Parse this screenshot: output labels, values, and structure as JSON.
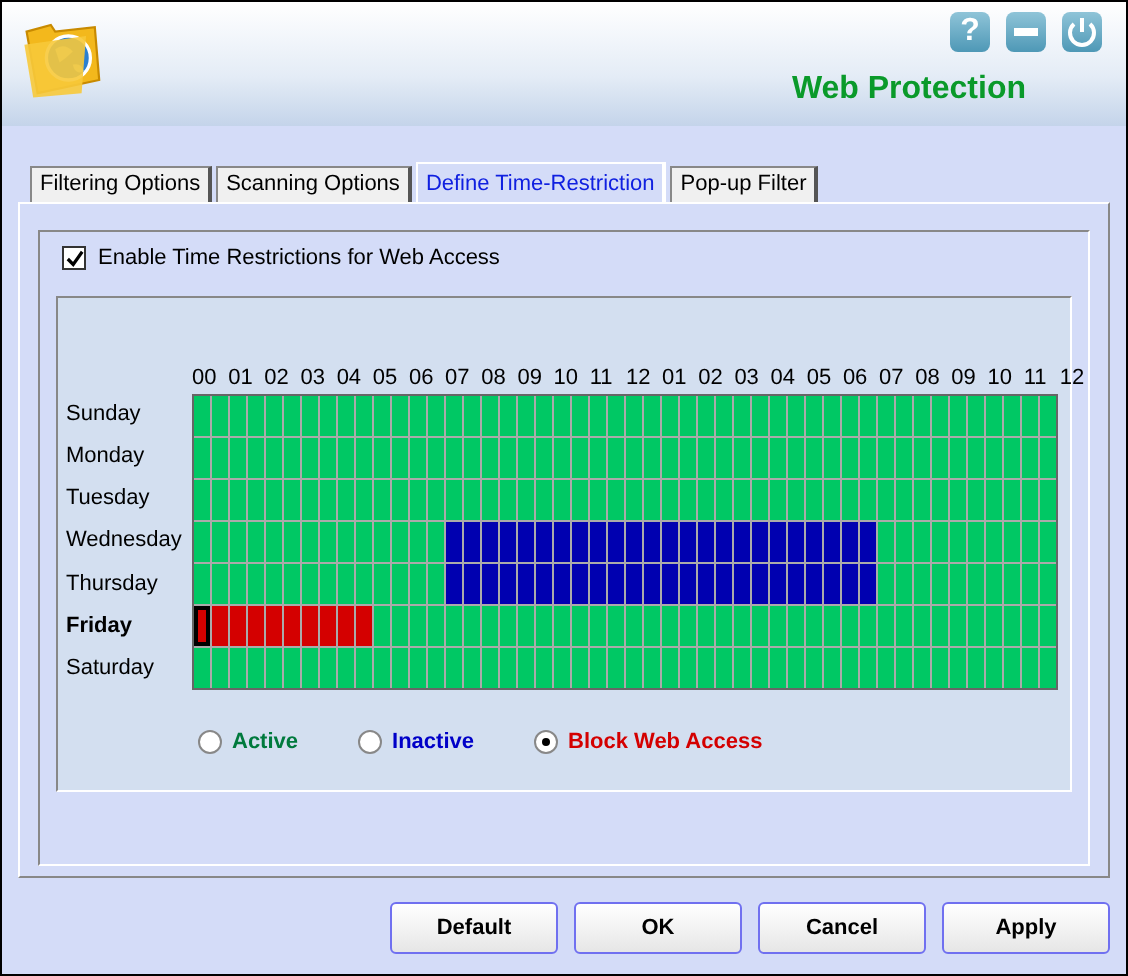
{
  "window": {
    "title": "Web Protection",
    "help_button": "?"
  },
  "tabs": [
    {
      "label": "Filtering Options",
      "selected": false
    },
    {
      "label": "Scanning Options",
      "selected": false
    },
    {
      "label": "Define Time-Restriction",
      "selected": true
    },
    {
      "label": "Pop-up Filter",
      "selected": false
    }
  ],
  "enable": {
    "label": "Enable Time Restrictions for Web Access",
    "checked": true
  },
  "hours": [
    "00",
    "01",
    "02",
    "03",
    "04",
    "05",
    "06",
    "07",
    "08",
    "09",
    "10",
    "11",
    "12",
    "01",
    "02",
    "03",
    "04",
    "05",
    "06",
    "07",
    "08",
    "09",
    "10",
    "11",
    "12"
  ],
  "days": [
    {
      "name": "Sunday",
      "selected": false,
      "slots": [
        {
          "kind": "active"
        },
        {
          "kind": "active"
        },
        {
          "kind": "active"
        },
        {
          "kind": "active"
        },
        {
          "kind": "active"
        },
        {
          "kind": "active"
        },
        {
          "kind": "active"
        },
        {
          "kind": "active"
        },
        {
          "kind": "active"
        },
        {
          "kind": "active"
        },
        {
          "kind": "active"
        },
        {
          "kind": "active"
        },
        {
          "kind": "active"
        },
        {
          "kind": "active"
        },
        {
          "kind": "active"
        },
        {
          "kind": "active"
        },
        {
          "kind": "active"
        },
        {
          "kind": "active"
        },
        {
          "kind": "active"
        },
        {
          "kind": "active"
        },
        {
          "kind": "active"
        },
        {
          "kind": "active"
        },
        {
          "kind": "active"
        },
        {
          "kind": "active"
        },
        {
          "kind": "active"
        },
        {
          "kind": "active"
        },
        {
          "kind": "active"
        },
        {
          "kind": "active"
        },
        {
          "kind": "active"
        },
        {
          "kind": "active"
        },
        {
          "kind": "active"
        },
        {
          "kind": "active"
        },
        {
          "kind": "active"
        },
        {
          "kind": "active"
        },
        {
          "kind": "active"
        },
        {
          "kind": "active"
        },
        {
          "kind": "active"
        },
        {
          "kind": "active"
        },
        {
          "kind": "active"
        },
        {
          "kind": "active"
        },
        {
          "kind": "active"
        },
        {
          "kind": "active"
        },
        {
          "kind": "active"
        },
        {
          "kind": "active"
        },
        {
          "kind": "active"
        },
        {
          "kind": "active"
        },
        {
          "kind": "active"
        },
        {
          "kind": "active"
        }
      ]
    },
    {
      "name": "Monday",
      "selected": false,
      "slots": [
        {
          "kind": "active"
        },
        {
          "kind": "active"
        },
        {
          "kind": "active"
        },
        {
          "kind": "active"
        },
        {
          "kind": "active"
        },
        {
          "kind": "active"
        },
        {
          "kind": "active"
        },
        {
          "kind": "active"
        },
        {
          "kind": "active"
        },
        {
          "kind": "active"
        },
        {
          "kind": "active"
        },
        {
          "kind": "active"
        },
        {
          "kind": "active"
        },
        {
          "kind": "active"
        },
        {
          "kind": "active"
        },
        {
          "kind": "active"
        },
        {
          "kind": "active"
        },
        {
          "kind": "active"
        },
        {
          "kind": "active"
        },
        {
          "kind": "active"
        },
        {
          "kind": "active"
        },
        {
          "kind": "active"
        },
        {
          "kind": "active"
        },
        {
          "kind": "active"
        },
        {
          "kind": "active"
        },
        {
          "kind": "active"
        },
        {
          "kind": "active"
        },
        {
          "kind": "active"
        },
        {
          "kind": "active"
        },
        {
          "kind": "active"
        },
        {
          "kind": "active"
        },
        {
          "kind": "active"
        },
        {
          "kind": "active"
        },
        {
          "kind": "active"
        },
        {
          "kind": "active"
        },
        {
          "kind": "active"
        },
        {
          "kind": "active"
        },
        {
          "kind": "active"
        },
        {
          "kind": "active"
        },
        {
          "kind": "active"
        },
        {
          "kind": "active"
        },
        {
          "kind": "active"
        },
        {
          "kind": "active"
        },
        {
          "kind": "active"
        },
        {
          "kind": "active"
        },
        {
          "kind": "active"
        },
        {
          "kind": "active"
        },
        {
          "kind": "active"
        }
      ]
    },
    {
      "name": "Tuesday",
      "selected": false,
      "slots": [
        {
          "kind": "active"
        },
        {
          "kind": "active"
        },
        {
          "kind": "active"
        },
        {
          "kind": "active"
        },
        {
          "kind": "active"
        },
        {
          "kind": "active"
        },
        {
          "kind": "active"
        },
        {
          "kind": "active"
        },
        {
          "kind": "active"
        },
        {
          "kind": "active"
        },
        {
          "kind": "active"
        },
        {
          "kind": "active"
        },
        {
          "kind": "active"
        },
        {
          "kind": "active"
        },
        {
          "kind": "active"
        },
        {
          "kind": "active"
        },
        {
          "kind": "active"
        },
        {
          "kind": "active"
        },
        {
          "kind": "active"
        },
        {
          "kind": "active"
        },
        {
          "kind": "active"
        },
        {
          "kind": "active"
        },
        {
          "kind": "active"
        },
        {
          "kind": "active"
        },
        {
          "kind": "active"
        },
        {
          "kind": "active"
        },
        {
          "kind": "active"
        },
        {
          "kind": "active"
        },
        {
          "kind": "active"
        },
        {
          "kind": "active"
        },
        {
          "kind": "active"
        },
        {
          "kind": "active"
        },
        {
          "kind": "active"
        },
        {
          "kind": "active"
        },
        {
          "kind": "active"
        },
        {
          "kind": "active"
        },
        {
          "kind": "active"
        },
        {
          "kind": "active"
        },
        {
          "kind": "active"
        },
        {
          "kind": "active"
        },
        {
          "kind": "active"
        },
        {
          "kind": "active"
        },
        {
          "kind": "active"
        },
        {
          "kind": "active"
        },
        {
          "kind": "active"
        },
        {
          "kind": "active"
        },
        {
          "kind": "active"
        },
        {
          "kind": "active"
        }
      ]
    },
    {
      "name": "Wednesday",
      "selected": false,
      "slots": [
        {
          "kind": "active"
        },
        {
          "kind": "active"
        },
        {
          "kind": "active"
        },
        {
          "kind": "active"
        },
        {
          "kind": "active"
        },
        {
          "kind": "active"
        },
        {
          "kind": "active"
        },
        {
          "kind": "active"
        },
        {
          "kind": "active"
        },
        {
          "kind": "active"
        },
        {
          "kind": "active"
        },
        {
          "kind": "active"
        },
        {
          "kind": "active"
        },
        {
          "kind": "active"
        },
        {
          "kind": "inactive"
        },
        {
          "kind": "inactive"
        },
        {
          "kind": "inactive"
        },
        {
          "kind": "inactive"
        },
        {
          "kind": "inactive"
        },
        {
          "kind": "inactive"
        },
        {
          "kind": "inactive"
        },
        {
          "kind": "inactive"
        },
        {
          "kind": "inactive"
        },
        {
          "kind": "inactive"
        },
        {
          "kind": "inactive"
        },
        {
          "kind": "inactive"
        },
        {
          "kind": "inactive"
        },
        {
          "kind": "inactive"
        },
        {
          "kind": "inactive"
        },
        {
          "kind": "inactive"
        },
        {
          "kind": "inactive"
        },
        {
          "kind": "inactive"
        },
        {
          "kind": "inactive"
        },
        {
          "kind": "inactive"
        },
        {
          "kind": "inactive"
        },
        {
          "kind": "inactive"
        },
        {
          "kind": "inactive"
        },
        {
          "kind": "inactive"
        },
        {
          "kind": "active"
        },
        {
          "kind": "active"
        },
        {
          "kind": "active"
        },
        {
          "kind": "active"
        },
        {
          "kind": "active"
        },
        {
          "kind": "active"
        },
        {
          "kind": "active"
        },
        {
          "kind": "active"
        },
        {
          "kind": "active"
        },
        {
          "kind": "active"
        }
      ]
    },
    {
      "name": "Thursday",
      "selected": false,
      "slots": [
        {
          "kind": "active"
        },
        {
          "kind": "active"
        },
        {
          "kind": "active"
        },
        {
          "kind": "active"
        },
        {
          "kind": "active"
        },
        {
          "kind": "active"
        },
        {
          "kind": "active"
        },
        {
          "kind": "active"
        },
        {
          "kind": "active"
        },
        {
          "kind": "active"
        },
        {
          "kind": "active"
        },
        {
          "kind": "active"
        },
        {
          "kind": "active"
        },
        {
          "kind": "active"
        },
        {
          "kind": "inactive"
        },
        {
          "kind": "inactive"
        },
        {
          "kind": "inactive"
        },
        {
          "kind": "inactive"
        },
        {
          "kind": "inactive"
        },
        {
          "kind": "inactive"
        },
        {
          "kind": "inactive"
        },
        {
          "kind": "inactive"
        },
        {
          "kind": "inactive"
        },
        {
          "kind": "inactive"
        },
        {
          "kind": "inactive"
        },
        {
          "kind": "inactive"
        },
        {
          "kind": "inactive"
        },
        {
          "kind": "inactive"
        },
        {
          "kind": "inactive"
        },
        {
          "kind": "inactive"
        },
        {
          "kind": "inactive"
        },
        {
          "kind": "inactive"
        },
        {
          "kind": "inactive"
        },
        {
          "kind": "inactive"
        },
        {
          "kind": "inactive"
        },
        {
          "kind": "inactive"
        },
        {
          "kind": "inactive"
        },
        {
          "kind": "inactive"
        },
        {
          "kind": "active"
        },
        {
          "kind": "active"
        },
        {
          "kind": "active"
        },
        {
          "kind": "active"
        },
        {
          "kind": "active"
        },
        {
          "kind": "active"
        },
        {
          "kind": "active"
        },
        {
          "kind": "active"
        },
        {
          "kind": "active"
        },
        {
          "kind": "active"
        }
      ]
    },
    {
      "name": "Friday",
      "selected": true,
      "slots": [
        {
          "kind": "block",
          "focused": true
        },
        {
          "kind": "block"
        },
        {
          "kind": "block"
        },
        {
          "kind": "block"
        },
        {
          "kind": "block"
        },
        {
          "kind": "block"
        },
        {
          "kind": "block"
        },
        {
          "kind": "block"
        },
        {
          "kind": "block"
        },
        {
          "kind": "block"
        },
        {
          "kind": "active"
        },
        {
          "kind": "active"
        },
        {
          "kind": "active"
        },
        {
          "kind": "active"
        },
        {
          "kind": "active"
        },
        {
          "kind": "active"
        },
        {
          "kind": "active"
        },
        {
          "kind": "active"
        },
        {
          "kind": "active"
        },
        {
          "kind": "active"
        },
        {
          "kind": "active"
        },
        {
          "kind": "active"
        },
        {
          "kind": "active"
        },
        {
          "kind": "active"
        },
        {
          "kind": "active"
        },
        {
          "kind": "active"
        },
        {
          "kind": "active"
        },
        {
          "kind": "active"
        },
        {
          "kind": "active"
        },
        {
          "kind": "active"
        },
        {
          "kind": "active"
        },
        {
          "kind": "active"
        },
        {
          "kind": "active"
        },
        {
          "kind": "active"
        },
        {
          "kind": "active"
        },
        {
          "kind": "active"
        },
        {
          "kind": "active"
        },
        {
          "kind": "active"
        },
        {
          "kind": "active"
        },
        {
          "kind": "active"
        },
        {
          "kind": "active"
        },
        {
          "kind": "active"
        },
        {
          "kind": "active"
        },
        {
          "kind": "active"
        },
        {
          "kind": "active"
        },
        {
          "kind": "active"
        },
        {
          "kind": "active"
        },
        {
          "kind": "active"
        }
      ]
    },
    {
      "name": "Saturday",
      "selected": false,
      "slots": [
        {
          "kind": "active"
        },
        {
          "kind": "active"
        },
        {
          "kind": "active"
        },
        {
          "kind": "active"
        },
        {
          "kind": "active"
        },
        {
          "kind": "active"
        },
        {
          "kind": "active"
        },
        {
          "kind": "active"
        },
        {
          "kind": "active"
        },
        {
          "kind": "active"
        },
        {
          "kind": "active"
        },
        {
          "kind": "active"
        },
        {
          "kind": "active"
        },
        {
          "kind": "active"
        },
        {
          "kind": "active"
        },
        {
          "kind": "active"
        },
        {
          "kind": "active"
        },
        {
          "kind": "active"
        },
        {
          "kind": "active"
        },
        {
          "kind": "active"
        },
        {
          "kind": "active"
        },
        {
          "kind": "active"
        },
        {
          "kind": "active"
        },
        {
          "kind": "active"
        },
        {
          "kind": "active"
        },
        {
          "kind": "active"
        },
        {
          "kind": "active"
        },
        {
          "kind": "active"
        },
        {
          "kind": "active"
        },
        {
          "kind": "active"
        },
        {
          "kind": "active"
        },
        {
          "kind": "active"
        },
        {
          "kind": "active"
        },
        {
          "kind": "active"
        },
        {
          "kind": "active"
        },
        {
          "kind": "active"
        },
        {
          "kind": "active"
        },
        {
          "kind": "active"
        },
        {
          "kind": "active"
        },
        {
          "kind": "active"
        },
        {
          "kind": "active"
        },
        {
          "kind": "active"
        },
        {
          "kind": "active"
        },
        {
          "kind": "active"
        },
        {
          "kind": "active"
        },
        {
          "kind": "active"
        },
        {
          "kind": "active"
        },
        {
          "kind": "active"
        }
      ]
    }
  ],
  "legend": [
    {
      "label": "Active",
      "color": "#007a3d",
      "selected": false
    },
    {
      "label": "Inactive",
      "color": "#0000c8",
      "selected": false
    },
    {
      "label": "Block Web Access",
      "color": "#d40000",
      "selected": true
    }
  ],
  "buttons": [
    "Default",
    "OK",
    "Cancel",
    "Apply"
  ]
}
